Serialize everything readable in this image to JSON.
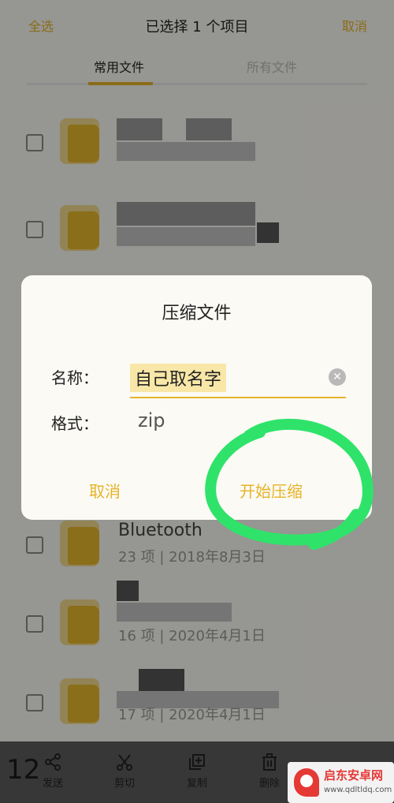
{
  "header": {
    "select_all": "全选",
    "title": "已选择 1 个项目",
    "cancel": "取消"
  },
  "tabs": [
    {
      "label": "常用文件",
      "active": true
    },
    {
      "label": "所有文件",
      "active": false
    }
  ],
  "files": [
    {
      "meta": ""
    },
    {
      "meta": ""
    },
    {
      "meta": ""
    },
    {
      "name": "Bluetooth",
      "meta": "23 项 | 2018年8月3日"
    },
    {
      "meta": "16 项 | 2020年4月1日"
    },
    {
      "meta": "17 项 | 2020年4月1日"
    }
  ],
  "dialog": {
    "title": "压缩文件",
    "name_label": "名称：",
    "name_value": "自己取名字",
    "format_label": "格式：",
    "format_value": "zip",
    "cancel": "取消",
    "start": "开始压缩"
  },
  "bottom_bar": {
    "selected_count": "12",
    "send": "发送",
    "cut": "剪切",
    "copy": "复制",
    "delete": "删除"
  },
  "watermark": {
    "name": "启东安卓网",
    "url": "www.qdltldq.com"
  },
  "colors": {
    "accent": "#e6b429",
    "folder": "#e8b82c",
    "highlight_circle": "#2fe36a",
    "dim_overlay": "rgba(0,0,0,0.4)"
  },
  "icons": [
    "share-icon",
    "scissors-icon",
    "copy-icon",
    "trash-icon",
    "more-icon",
    "clear-icon",
    "folder-icon"
  ]
}
